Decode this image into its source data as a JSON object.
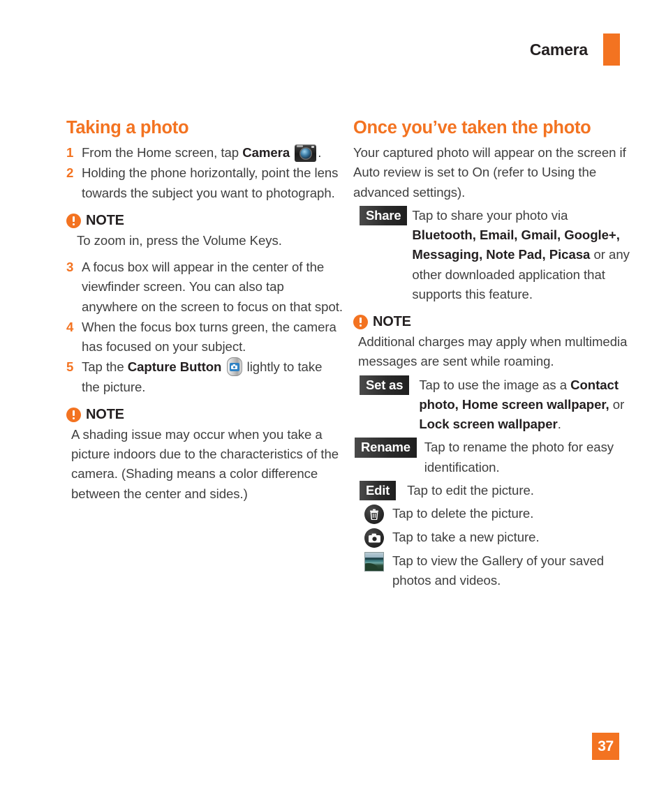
{
  "header": {
    "title": "Camera",
    "accent_color": "#f37321"
  },
  "left_column": {
    "heading": "Taking a photo",
    "steps": [
      {
        "num": "1",
        "text_before": "From the Home screen, tap ",
        "bold": "Camera",
        "icon": "camera-icon",
        "text_after": "."
      },
      {
        "num": "2",
        "text_before": "Holding the phone horizontally, point the lens towards the subject you want to photograph.",
        "bold": "",
        "icon": "",
        "text_after": ""
      }
    ],
    "note1": {
      "label": "NOTE",
      "body": "To zoom in, press the Volume Keys."
    },
    "steps2": [
      {
        "num": "3",
        "text_before": "A focus box will appear in the center of the viewfinder screen. You can also tap anywhere on the screen to focus on that spot.",
        "bold": "",
        "icon": "",
        "text_after": ""
      },
      {
        "num": "4",
        "text_before": "When the focus box turns green, the camera has focused on your subject.",
        "bold": "",
        "icon": "",
        "text_after": ""
      },
      {
        "num": "5",
        "text_before": "Tap the ",
        "bold": "Capture Button",
        "icon": "capture-button-icon",
        "text_after": " lightly to take the picture."
      }
    ],
    "note2": {
      "label": "NOTE",
      "body": "A shading issue may occur when you take a picture indoors due to the characteristics of the camera. (Shading means a color difference between the center and sides.)"
    }
  },
  "right_column": {
    "heading": "Once you’ve taken the photo",
    "intro": "Your captured photo will appear on the screen if Auto review is set to On (refer to Using the advanced settings).",
    "share": {
      "badge": "Share",
      "text_1": "Tap to share your photo via ",
      "apps": "Bluetooth, Email, Gmail, Google+, Messaging, Note Pad, Picasa",
      "text_2": " or any other downloaded application that supports this feature."
    },
    "note": {
      "label": "NOTE",
      "body": "Additional charges may apply when multimedia messages are sent while roaming."
    },
    "set_as": {
      "badge": "Set as",
      "text_1": "Tap to use the image as a ",
      "bold_1": "Contact photo, Home screen wallpaper,",
      "text_2": " or ",
      "bold_2": "Lock screen wallpaper",
      "text_3": "."
    },
    "rename": {
      "badge": "Rename",
      "text": "Tap to rename the photo for easy identification."
    },
    "edit": {
      "badge": "Edit",
      "text": "Tap to edit the picture."
    },
    "icon_rows": [
      {
        "icon": "trash-icon",
        "text": "Tap to delete the picture."
      },
      {
        "icon": "camera-circle-icon",
        "text": "Tap to take a new picture."
      },
      {
        "icon": "gallery-thumbnail-icon",
        "text": "Tap to view the Gallery of your saved photos and videos."
      }
    ]
  },
  "footer": {
    "page_number": "37"
  }
}
